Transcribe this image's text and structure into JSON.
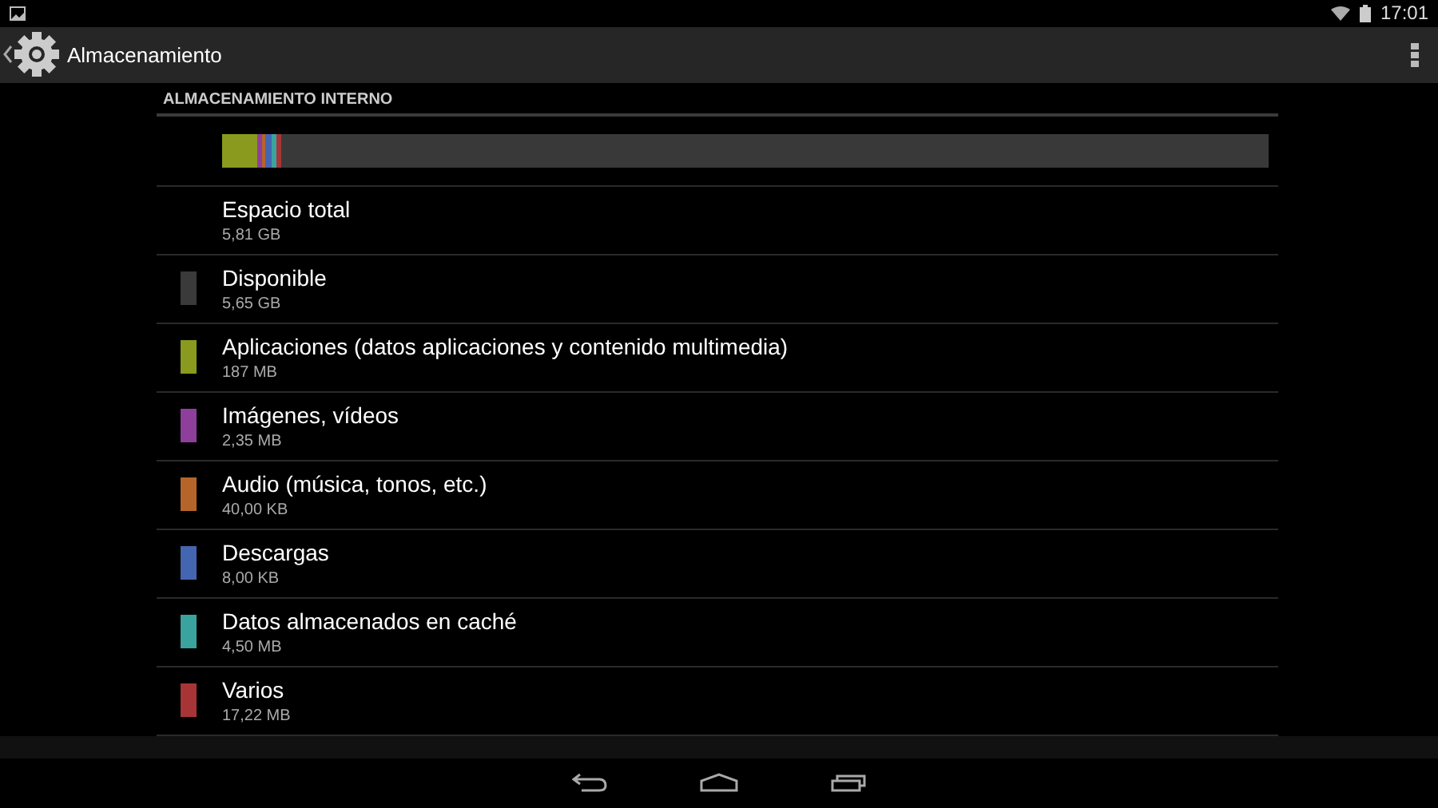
{
  "status_bar": {
    "time": "17:01"
  },
  "action_bar": {
    "title": "Almacenamiento"
  },
  "section": {
    "header": "ALMACENAMIENTO INTERNO"
  },
  "storage_bar": [
    {
      "color": "#8a9a1e",
      "level": 0.033
    },
    {
      "color": "#8e3f9c",
      "level": 0.005
    },
    {
      "color": "#b5652a",
      "level": 0.004
    },
    {
      "color": "#4466b0",
      "level": 0.006
    },
    {
      "color": "#3aa3a0",
      "level": 0.004
    },
    {
      "color": "#a83535",
      "level": 0.005
    }
  ],
  "items": [
    {
      "kind": "total",
      "title": "Espacio total",
      "summary": "5,81 GB"
    },
    {
      "kind": "category",
      "color": "#3a3a3a",
      "title": "Disponible",
      "summary": "5,65 GB"
    },
    {
      "kind": "category",
      "color": "#8a9a1e",
      "title": "Aplicaciones (datos aplicaciones y contenido multimedia)",
      "summary": "187 MB"
    },
    {
      "kind": "category",
      "color": "#8e3f9c",
      "title": "Imágenes, vídeos",
      "summary": "2,35 MB"
    },
    {
      "kind": "category",
      "color": "#b5652a",
      "title": "Audio (música, tonos, etc.)",
      "summary": "40,00 KB"
    },
    {
      "kind": "category",
      "color": "#4466b0",
      "title": "Descargas",
      "summary": "8,00 KB"
    },
    {
      "kind": "category",
      "color": "#3aa3a0",
      "title": "Datos almacenados en caché",
      "summary": "4,50 MB"
    },
    {
      "kind": "category",
      "color": "#a83535",
      "title": "Varios",
      "summary": "17,22 MB"
    }
  ]
}
